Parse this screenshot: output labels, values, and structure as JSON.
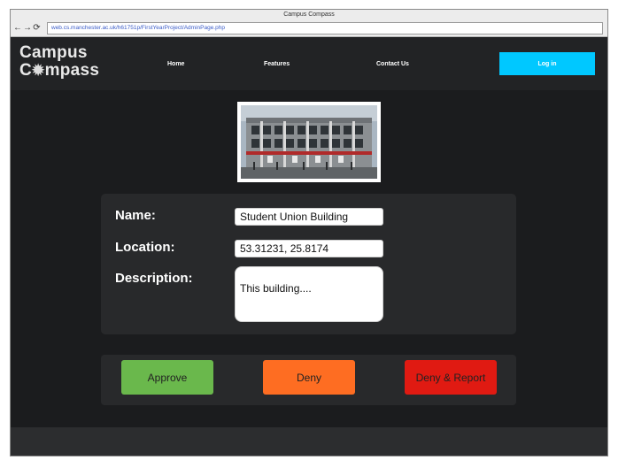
{
  "browser": {
    "window_title": "Campus Compass",
    "url": "web.cs.manchester.ac.uk/h61751p/FirstYearProject/AdminPage.php",
    "nav_icons": [
      "back-arrow-icon",
      "forward-arrow-icon",
      "reload-icon"
    ]
  },
  "header": {
    "logo_line1": "Campus",
    "logo_line2_prefix": "C",
    "logo_line2_suffix": "mpass",
    "logo_icon": "compass-gear-icon",
    "nav": {
      "home": "Home",
      "features": "Features",
      "contact": "Contact Us"
    },
    "login_label": "Log in"
  },
  "building": {
    "photo": "building-photo",
    "name_label": "Name:",
    "name_value": "Student Union Building",
    "location_label": "Location:",
    "location_value": "53.31231, 25.8174",
    "description_label": "Description:",
    "description_value": "This building...."
  },
  "actions": {
    "approve": "Approve",
    "deny": "Deny",
    "deny_report": "Deny & Report"
  },
  "colors": {
    "page_bg": "#1b1c1e",
    "header_bg": "#222325",
    "card_bg": "#28292b",
    "login_accent": "#00c8ff",
    "approve": "#6ab84c",
    "deny": "#fe6d22",
    "deny_report": "#e01a12"
  }
}
